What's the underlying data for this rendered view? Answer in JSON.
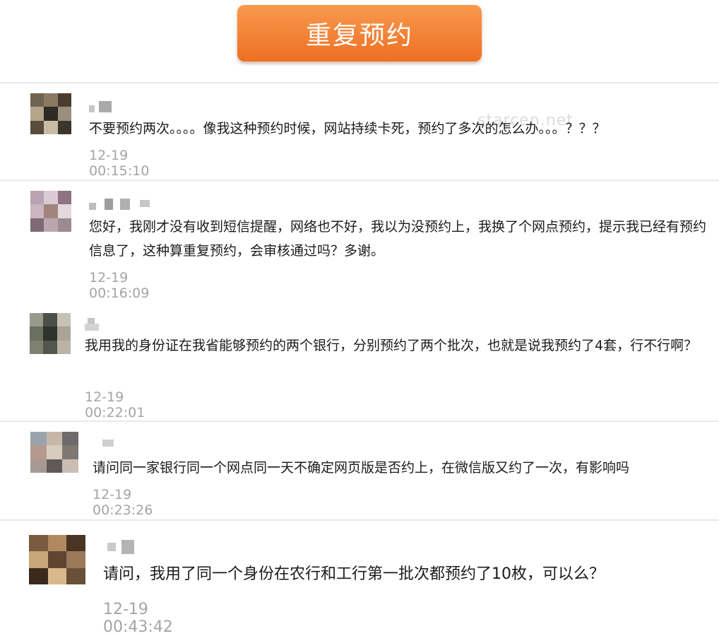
{
  "header": {
    "button_label": "重复预约"
  },
  "watermark": "starcen.net",
  "comments": [
    {
      "text": "不要预约两次。。。。像我这种预约时候，网站持续卡死，预约了多次的怎么办。。。？？？",
      "time": "12-19 00:15:10",
      "avatar_colors": [
        "#6f6450",
        "#8a7a62",
        "#4a3d30",
        "#b5a589",
        "#2e2a25",
        "#9a8f7c",
        "#5a4c3c",
        "#c8bca5",
        "#3b352d"
      ]
    },
    {
      "text": "您好，我刚才没有收到短信提醒，网络也不好，我以为没预约上，我换了个网点预约，提示我已经有预约信息了，这种算重复预约，会审核通过吗？多谢。",
      "time": "12-19 00:16:09",
      "avatar_colors": [
        "#b7a3b2",
        "#d8cbd3",
        "#8e7385",
        "#c9b6c0",
        "#a2847f",
        "#e3d8dc",
        "#7d6a74",
        "#bca6ae",
        "#9c8a93"
      ]
    },
    {
      "text": "我用我的身份证在我省能够预约的两个银行，分别预约了两个批次，也就是说我预约了4套，行不行啊？",
      "time": "12-19 00:22:01",
      "avatar_colors": [
        "#9a9a8c",
        "#4d5046",
        "#c6c2b5",
        "#6b6f60",
        "#2f332c",
        "#aaa494",
        "#7e8070",
        "#53564b",
        "#b9b4a6"
      ]
    },
    {
      "text": "请问同一家银行同一个网点同一天不确定网页版是否约上，在微信版又约了一次，有影响吗",
      "time": "12-19 00:23:26",
      "avatar_colors": [
        "#9aa3ad",
        "#c7b7a8",
        "#6e6a6c",
        "#b49a8c",
        "#d8cbc0",
        "#7e7870",
        "#a89a92",
        "#5f5a58",
        "#cbbdb2"
      ]
    },
    {
      "text": "请问，我用了同一个身份在农行和工行第一批次都预约了10枚，可以么？",
      "time": "12-19 00:43:42",
      "avatar_colors": [
        "#7a5a3e",
        "#b08a5e",
        "#4a3424",
        "#c9a57a",
        "#5e4632",
        "#9a7a58",
        "#3a2a1e",
        "#d8b88c",
        "#6a5038"
      ]
    }
  ]
}
